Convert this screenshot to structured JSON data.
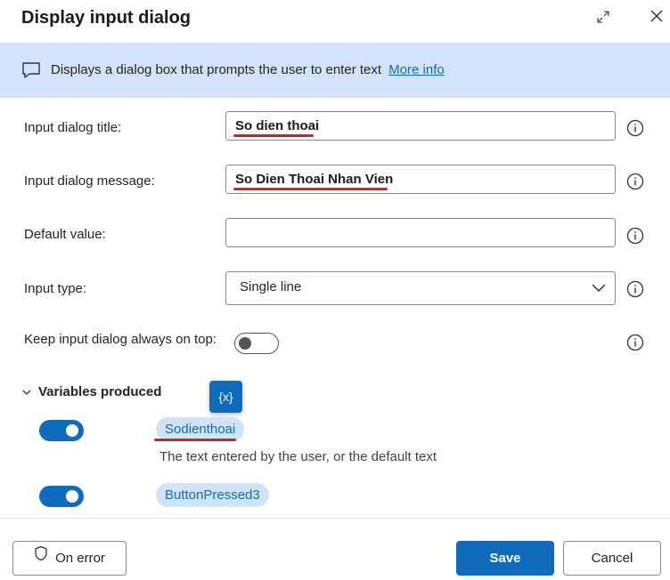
{
  "dialog": {
    "title": "Display input dialog"
  },
  "banner": {
    "text": "Displays a dialog box that prompts the user to enter text",
    "link": "More info"
  },
  "fields": {
    "title_label": "Input dialog title:",
    "title_value": "So dien thoai",
    "message_label": "Input dialog message:",
    "message_value": "So Dien Thoai Nhan Vien",
    "default_label": "Default value:",
    "default_value": "",
    "type_label": "Input type:",
    "type_value": "Single line",
    "ontop_label": "Keep input dialog always on top:",
    "ontop_enabled": false
  },
  "variables": {
    "header": "Variables produced",
    "badge": "{x}",
    "items": [
      {
        "name": "Sodienthoai",
        "description": "The text entered by the user, or the default text",
        "enabled": true
      },
      {
        "name": "ButtonPressed3",
        "enabled": true
      }
    ]
  },
  "footer": {
    "on_error": "On error",
    "save": "Save",
    "cancel": "Cancel"
  },
  "colors": {
    "accent": "#0f6cbd",
    "banner_bg": "#d3e3fd",
    "annotation_red": "#d9201c"
  }
}
